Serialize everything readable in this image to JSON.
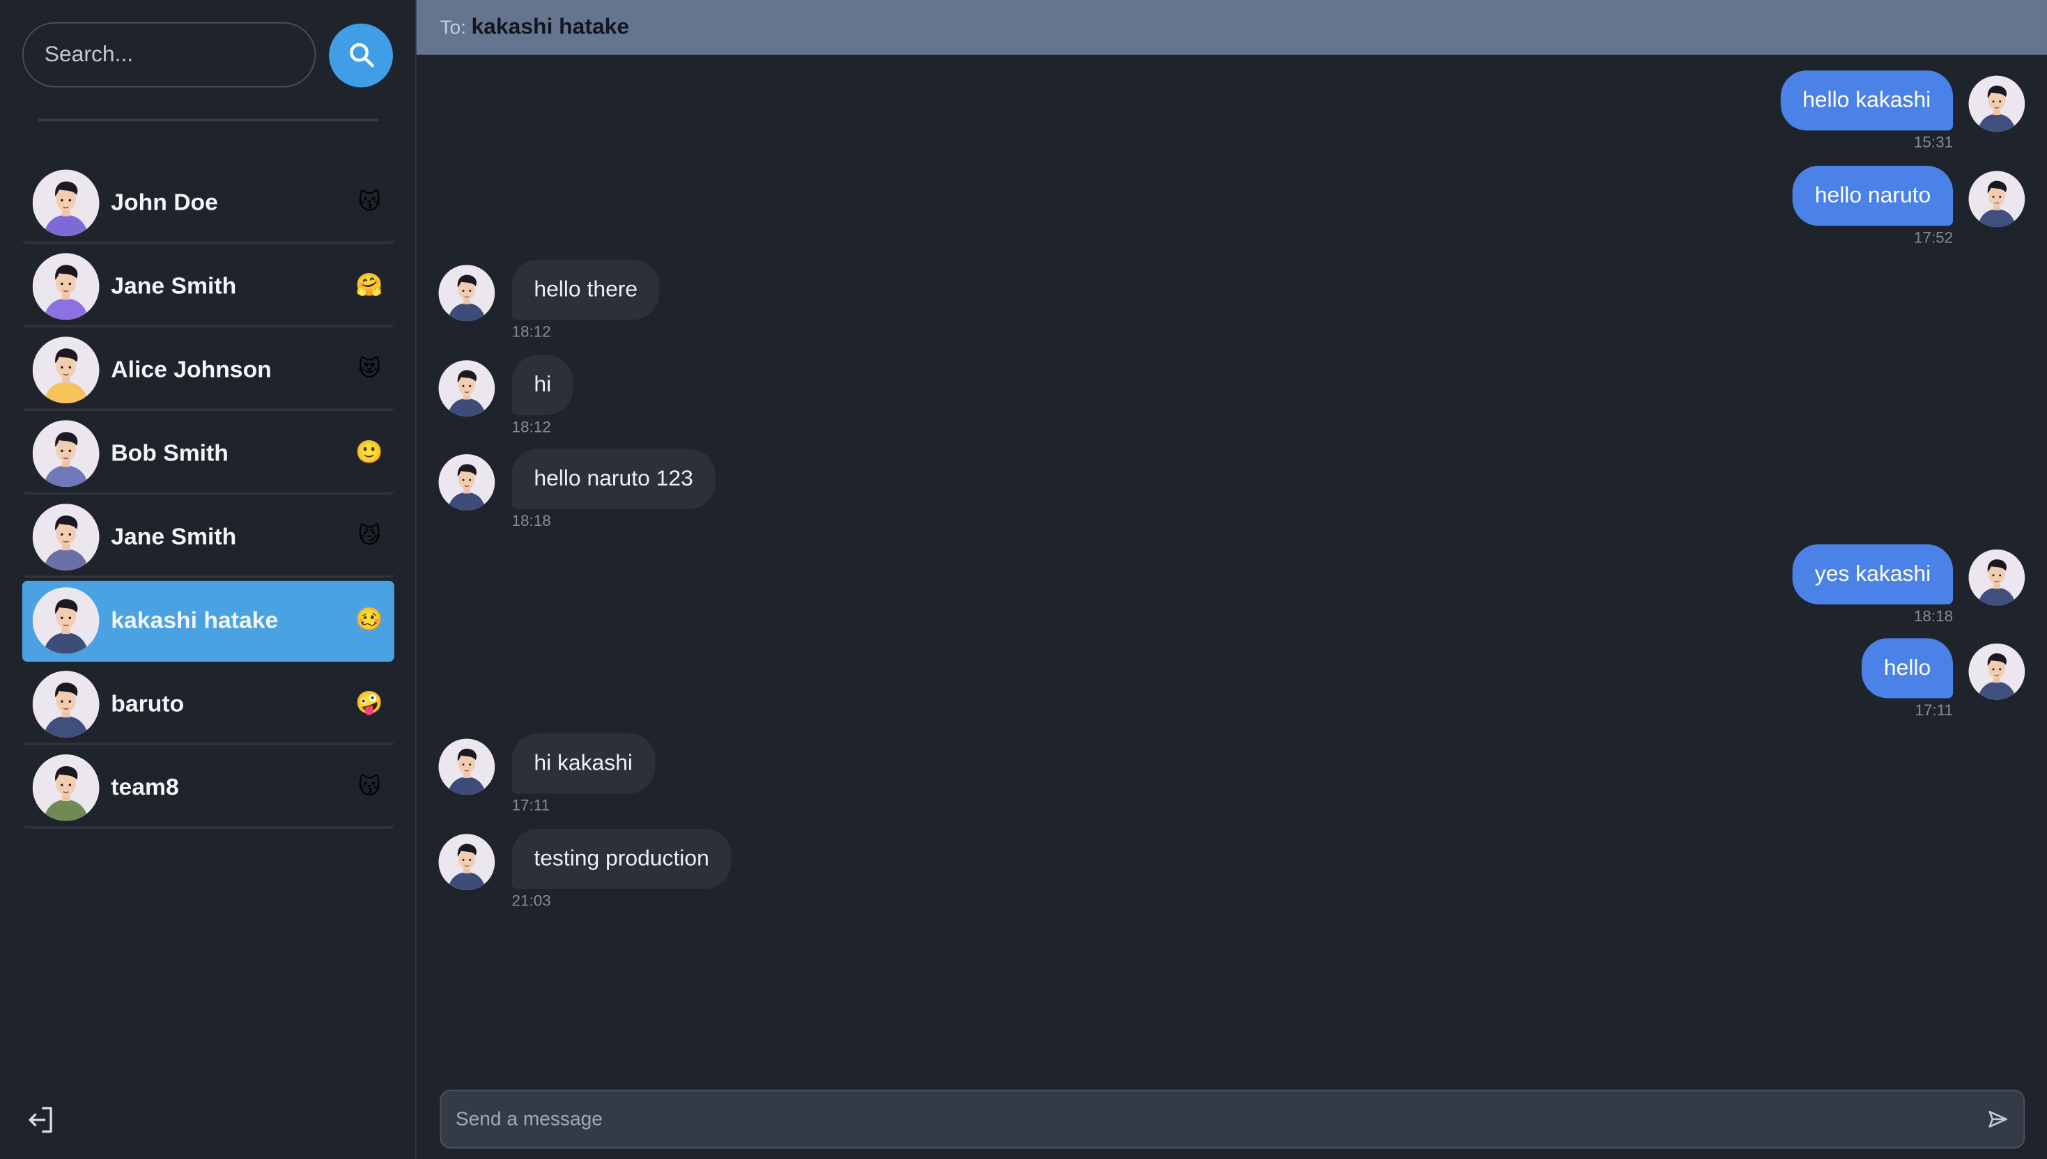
{
  "search": {
    "placeholder": "Search..."
  },
  "contacts": [
    {
      "name": "John Doe",
      "emoji": "😽",
      "active": false
    },
    {
      "name": "Jane Smith",
      "emoji": "🤗",
      "active": false
    },
    {
      "name": "Alice Johnson",
      "emoji": "😻",
      "active": false
    },
    {
      "name": "Bob Smith",
      "emoji": "🙂",
      "active": false
    },
    {
      "name": "Jane Smith",
      "emoji": "😼",
      "active": false
    },
    {
      "name": "kakashi hatake",
      "emoji": "🥴",
      "active": true
    },
    {
      "name": "baruto",
      "emoji": "🤪",
      "active": false
    },
    {
      "name": "team8",
      "emoji": "😽",
      "active": false
    }
  ],
  "header": {
    "to_label": "To:",
    "recipient": "kakashi hatake"
  },
  "messages": [
    {
      "direction": "out",
      "text": "hello kakashi",
      "time": "15:31"
    },
    {
      "direction": "out",
      "text": "hello naruto",
      "time": "17:52"
    },
    {
      "direction": "in",
      "text": "hello there",
      "time": "18:12"
    },
    {
      "direction": "in",
      "text": "hi",
      "time": "18:12"
    },
    {
      "direction": "in",
      "text": "hello naruto 123",
      "time": "18:18"
    },
    {
      "direction": "out",
      "text": "yes kakashi",
      "time": "18:18"
    },
    {
      "direction": "out",
      "text": "hello",
      "time": "17:11"
    },
    {
      "direction": "in",
      "text": "hi kakashi",
      "time": "17:11"
    },
    {
      "direction": "in",
      "text": "testing production",
      "time": "21:03"
    }
  ],
  "composer": {
    "placeholder": "Send a message"
  },
  "colors": {
    "accent": "#3f9ee6",
    "active_contact": "#4aa2e2",
    "outgoing_bubble": "#4a82e8",
    "incoming_bubble": "#2b303a",
    "header_bar": "#66758e"
  }
}
